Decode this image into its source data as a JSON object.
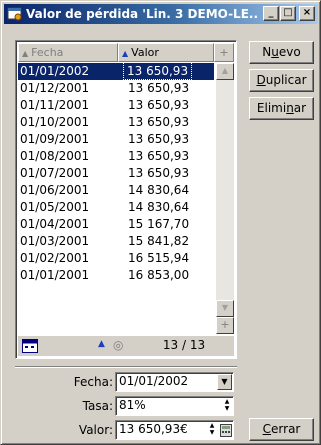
{
  "window": {
    "title": "Valor de pérdida 'Lin. 3 DEMO-LE...",
    "min_glyph": "_",
    "max_glyph": "□",
    "close_glyph": "×"
  },
  "grid": {
    "columns": [
      {
        "label": "Fecha",
        "sort_glyph": "▲"
      },
      {
        "label": "Valor",
        "sort_glyph": "▲"
      },
      {
        "label": "+"
      }
    ],
    "rows": [
      {
        "fecha": "01/01/2002",
        "valor": "13 650,93"
      },
      {
        "fecha": "01/12/2001",
        "valor": "13 650,93"
      },
      {
        "fecha": "01/11/2001",
        "valor": "13 650,93"
      },
      {
        "fecha": "01/10/2001",
        "valor": "13 650,93"
      },
      {
        "fecha": "01/09/2001",
        "valor": "13 650,93"
      },
      {
        "fecha": "01/08/2001",
        "valor": "13 650,93"
      },
      {
        "fecha": "01/07/2001",
        "valor": "13 650,93"
      },
      {
        "fecha": "01/06/2001",
        "valor": "14 830,64"
      },
      {
        "fecha": "01/05/2001",
        "valor": "14 830,64"
      },
      {
        "fecha": "01/04/2001",
        "valor": "15 167,70"
      },
      {
        "fecha": "01/03/2001",
        "valor": "15 841,82"
      },
      {
        "fecha": "01/02/2001",
        "valor": "16 515,94"
      },
      {
        "fecha": "01/01/2001",
        "valor": "16 853,00"
      }
    ],
    "selected_index": 0,
    "footer": {
      "count": "13 / 13",
      "up_glyph": "▲",
      "plus_glyph": "+"
    }
  },
  "form": {
    "fecha": {
      "label": "Fecha:",
      "value": "01/01/2002"
    },
    "tasa": {
      "label": "Tasa:",
      "value": "81%"
    },
    "valor": {
      "label": "Valor:",
      "value": "13 650,93€"
    }
  },
  "buttons": {
    "nuevo": {
      "pre": "N",
      "ul": "u",
      "post": "evo"
    },
    "duplicar": {
      "pre": "",
      "ul": "D",
      "post": "uplicar"
    },
    "eliminar": {
      "pre": "Elimi",
      "ul": "n",
      "post": "ar"
    },
    "cerrar": {
      "pre": "",
      "ul": "C",
      "post": "errar"
    }
  },
  "colors": {
    "title_start": "#0a246a",
    "title_end": "#a6caf0",
    "selection": "#0a246a",
    "face": "#d4d0c8"
  }
}
